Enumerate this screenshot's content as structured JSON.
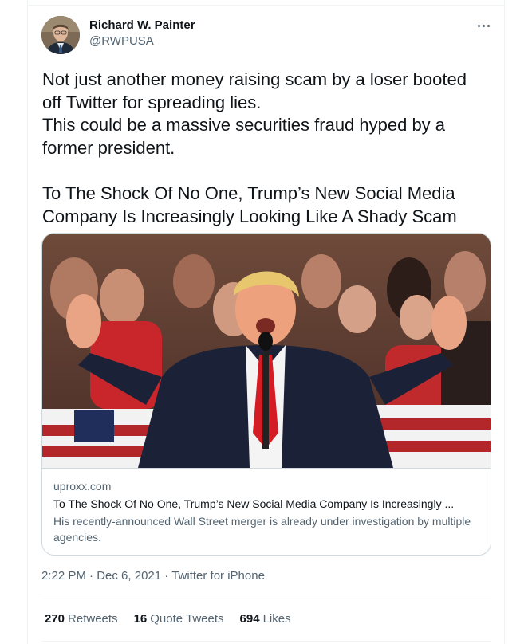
{
  "author": {
    "name": "Richard W. Painter",
    "handle": "@RWPUSA"
  },
  "tweet": {
    "lines": [
      "Not just another money raising scam by a loser booted",
      "off Twitter for spreading lies.",
      "This could be a massive securities fraud hyped by a",
      "former president."
    ],
    "headline_lines": [
      "To The Shock Of No One, Trump’s New Social Media",
      "Company Is Increasingly Looking Like A Shady Scam"
    ]
  },
  "card": {
    "domain": "uproxx.com",
    "title": "To The Shock Of No One, Trump’s New Social Media Company Is Increasingly ...",
    "description": "His recently-announced Wall Street merger is already under investigation by multiple agencies."
  },
  "meta": {
    "time": "2:22 PM",
    "separator": "·",
    "date": "Dec 6, 2021",
    "source": "Twitter for iPhone"
  },
  "stats": {
    "retweets_count": "270",
    "retweets_label": "Retweets",
    "quotes_count": "16",
    "quotes_label": "Quote Tweets",
    "likes_count": "694",
    "likes_label": "Likes"
  },
  "icons": {
    "more": "more-horizontal-icon"
  },
  "colors": {
    "text_primary": "#0f1419",
    "text_secondary": "#536471",
    "border": "#cfd9de",
    "divider": "#eff3f4"
  }
}
